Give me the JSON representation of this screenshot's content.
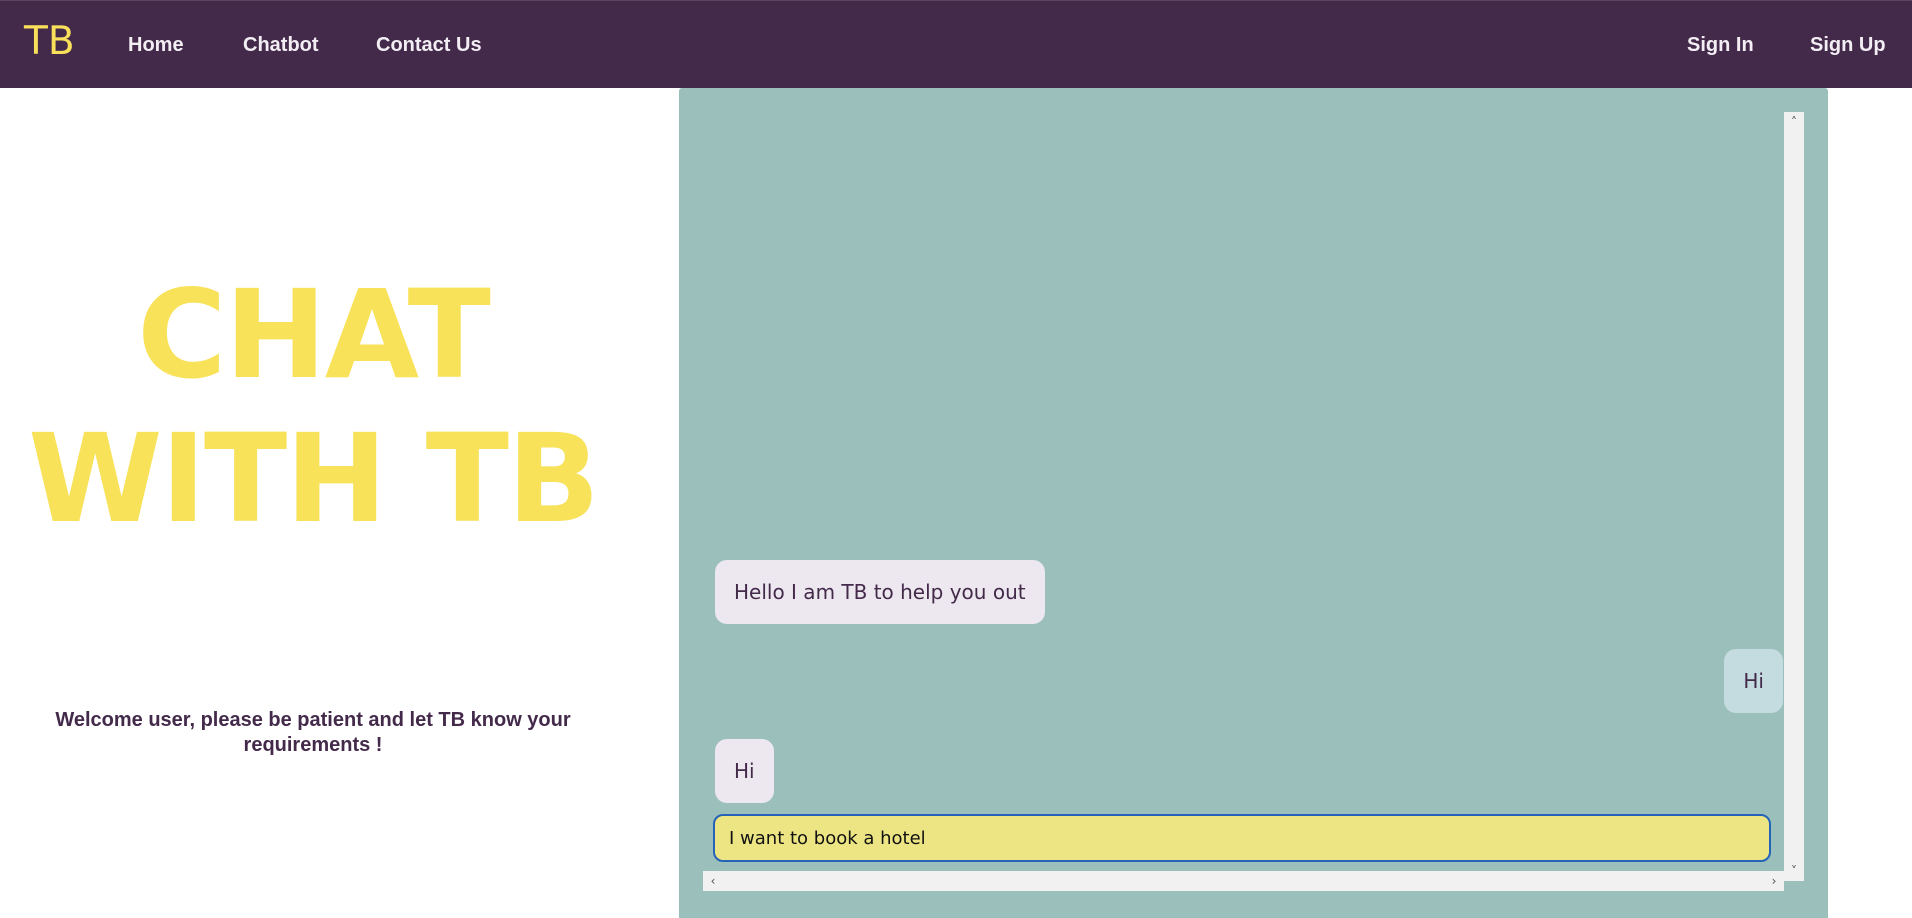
{
  "navbar": {
    "brand": "TB",
    "links": [
      {
        "label": "Home"
      },
      {
        "label": "Chatbot"
      },
      {
        "label": "Contact Us"
      }
    ],
    "auth": {
      "sign_in": "Sign In",
      "sign_up": "Sign Up"
    }
  },
  "hero": {
    "title_line1": "CHAT",
    "title_line2": "WITH TB",
    "welcome": "Welcome user, please be patient and let TB know your requirements !"
  },
  "chat": {
    "messages": [
      {
        "sender": "bot",
        "text": "Hello I am TB to help you out"
      },
      {
        "sender": "user",
        "text": "Hi"
      },
      {
        "sender": "bot",
        "text": "Hi"
      }
    ],
    "input_value": "I want to book a hotel"
  },
  "colors": {
    "navbar_bg": "#432a4a",
    "accent_yellow": "#f8e05a",
    "chat_bg": "#9bc0bc",
    "bot_bubble": "#ede8ef",
    "user_bubble": "#c4dce0",
    "input_bg": "#ede584",
    "input_border": "#2563b8"
  },
  "icons": {
    "scroll_up": "chevron-up-icon",
    "scroll_down": "chevron-down-icon",
    "scroll_left": "chevron-left-icon",
    "scroll_right": "chevron-right-icon"
  }
}
